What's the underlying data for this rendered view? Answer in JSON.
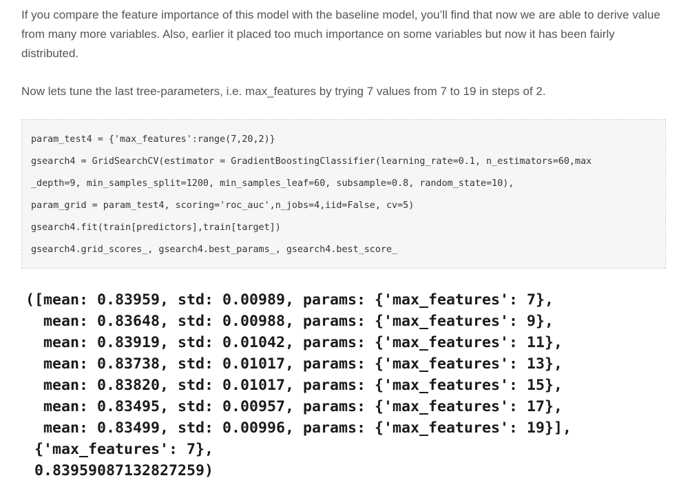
{
  "paragraphs": {
    "p1": "If you compare the feature importance of this model with the baseline model, you’ll find that now we are able to derive value from many more variables. Also, earlier it placed too much importance on some variables but now it has been fairly distributed.",
    "p2": "Now lets tune the last tree-parameters, i.e. max_features by trying 7 values from 7 to 19 in steps of 2."
  },
  "code": {
    "lines": [
      "param_test4 = {'max_features':range(7,20,2)}",
      "gsearch4 = GridSearchCV(estimator = GradientBoostingClassifier(learning_rate=0.1, n_estimators=60,max",
      "_depth=9, min_samples_split=1200, min_samples_leaf=60, subsample=0.8, random_state=10),",
      "param_grid = param_test4, scoring='roc_auc',n_jobs=4,iid=False, cv=5)",
      "gsearch4.fit(train[predictors],train[target])",
      "gsearch4.grid_scores_, gsearch4.best_params_, gsearch4.best_score_"
    ]
  },
  "output": {
    "lines": [
      "([mean: 0.83959, std: 0.00989, params: {'max_features': 7},",
      "  mean: 0.83648, std: 0.00988, params: {'max_features': 9},",
      "  mean: 0.83919, std: 0.01042, params: {'max_features': 11},",
      "  mean: 0.83738, std: 0.01017, params: {'max_features': 13},",
      "  mean: 0.83820, std: 0.01017, params: {'max_features': 15},",
      "  mean: 0.83495, std: 0.00957, params: {'max_features': 17},",
      "  mean: 0.83499, std: 0.00996, params: {'max_features': 19}],",
      " {'max_features': 7},",
      " 0.83959087132827259)"
    ]
  }
}
